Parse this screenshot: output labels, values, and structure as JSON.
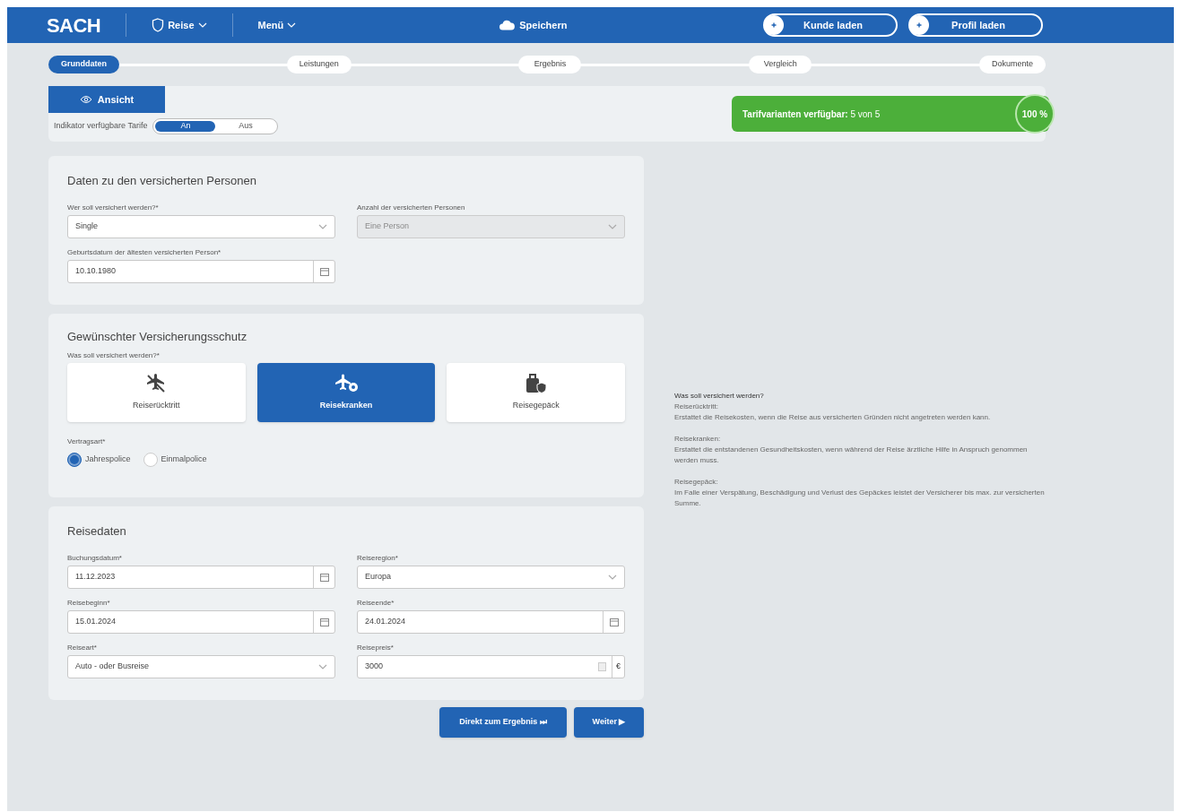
{
  "header": {
    "logo": "SACH",
    "menus": [
      {
        "label": "Reise",
        "kind": "product"
      },
      {
        "label": "Menü",
        "kind": "plain"
      }
    ],
    "save": "Speichern",
    "buttons": [
      "Kunde laden",
      "Profil laden"
    ]
  },
  "stepper": [
    {
      "label": "Grunddaten",
      "selected": true
    },
    {
      "label": "Leistungen",
      "selected": false
    },
    {
      "label": "Ergebnis",
      "selected": false
    },
    {
      "label": "Vergleich",
      "selected": false
    },
    {
      "label": "Dokumente",
      "selected": false
    }
  ],
  "view_panel": {
    "tab": "Ansicht",
    "indicator_label": "Indikator verfügbare Tarife",
    "toggle": [
      {
        "label": "An",
        "selected": true
      },
      {
        "label": "Aus",
        "selected": false
      }
    ],
    "availability": {
      "text": "**Tarifvarianten verfügbar:** 5 von 5",
      "level": 1,
      "percent": "100 %"
    }
  },
  "sections": [
    {
      "title": "Daten zu den versicherten Personen",
      "fields": [
        {
          "label": "Wer soll versichert werden?*",
          "value": "Single",
          "kind": "select",
          "disabled": false
        },
        {
          "label": "Anzahl der versicherten Personen",
          "value": "Eine Person",
          "kind": "select",
          "disabled": true
        },
        {
          "label": "Geburtsdatum der ältesten versicherten Person*",
          "value": "10.10.1980",
          "kind": "date",
          "disabled": false
        }
      ]
    },
    {
      "title": "Gewünschter Versicherungsschutz",
      "coverage_label": "Was soll versichert werden?*",
      "coverage": [
        {
          "label": "Reiserücktritt",
          "kind": "cancel",
          "selected": false
        },
        {
          "label": "Reisekranken",
          "kind": "health",
          "selected": true
        },
        {
          "label": "Reisegepäck",
          "kind": "luggage",
          "selected": false
        }
      ],
      "contract_label": "Vertragsart*",
      "contract": [
        {
          "label": "Jahrespolice",
          "selected": true
        },
        {
          "label": "Einmalpolice",
          "selected": false
        }
      ]
    },
    {
      "title": "Reisedaten",
      "fields": [
        {
          "label": "Buchungsdatum*",
          "value": "11.12.2023",
          "kind": "date",
          "disabled": false
        },
        {
          "label": "Reiseregion*",
          "value": "Europa",
          "kind": "select",
          "disabled": false
        },
        {
          "label": "Reisebeginn*",
          "value": "15.01.2024",
          "kind": "date",
          "disabled": false
        },
        {
          "label": "Reiseende*",
          "value": "24.01.2024",
          "kind": "date",
          "disabled": false
        },
        {
          "label": "Reiseart*",
          "value": "Auto - oder Busreise",
          "kind": "select",
          "disabled": false
        },
        {
          "label": "Reisepreis*",
          "value": "3000",
          "kind": "currency",
          "unit": "€",
          "disabled": false
        }
      ]
    }
  ],
  "actions": [
    "Direkt zum Ergebnis ⏭",
    "Weiter ▶"
  ],
  "info": [
    {
      "kind": "heading",
      "text": "Was soll versichert werden?"
    },
    {
      "kind": "term",
      "text": "Reiserücktritt:"
    },
    {
      "kind": "desc",
      "text": "Erstattet die Reisekosten, wenn die Reise aus versicherten Gründen nicht angetreten werden kann."
    },
    {
      "kind": "term",
      "text": "Reisekranken:"
    },
    {
      "kind": "desc",
      "text": "Erstattet die entstandenen Gesundheitskosten, wenn während der Reise ärztliche Hilfe in Anspruch genommen werden muss."
    },
    {
      "kind": "term",
      "text": "Reisegepäck:"
    },
    {
      "kind": "desc",
      "text": "Im Falle einer Verspätung, Beschädigung und Verlust des Gepäckes leistet der Versicherer bis max. zur versicherten Summe."
    }
  ]
}
